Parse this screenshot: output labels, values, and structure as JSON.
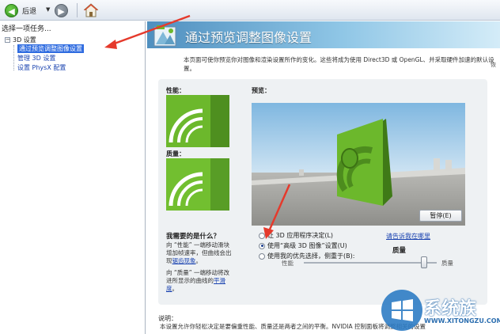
{
  "toolbar": {
    "back_label": "后退",
    "back_icon": "arrow-left-icon",
    "forward_icon": "arrow-right-icon",
    "home_icon": "home-icon",
    "dropdown_glyph": "▼"
  },
  "sidebar": {
    "title": "选择一项任务...",
    "root": {
      "label": "3D 设置",
      "expander": "−"
    },
    "items": [
      {
        "label": "通过预览调整图像设置",
        "selected": true
      },
      {
        "label": "管理 3D 设置",
        "selected": false
      },
      {
        "label": "设置 PhysX 配置",
        "selected": false
      }
    ]
  },
  "header": {
    "title": "通过预览调整图像设置",
    "icon": "nvidia-3d-settings-icon"
  },
  "description": "本页面可使你预览你对图像和渲染设置所作的变化。这些将成为使用 Direct3D 或 OpenGL、并采取硬件加速的默认设置。",
  "edge_text": "恢",
  "panel": {
    "performance_label": "性能：",
    "quality_label": "质量：",
    "preview_label": "预览：",
    "question_title": "我需要的是什么？",
    "performance_help": "向 “性能” 一端移动滑块增加帧速率，但曲线会出现",
    "performance_link": "锯齿现象",
    "quality_help": "向 “质量” 一端移动将改进所显示的曲线的",
    "quality_link": "平滑度",
    "pause_button": "暂停(E)",
    "options": [
      {
        "label": "让 3D 应用程序决定(L)",
        "checked": false
      },
      {
        "label": "使用“高级 3D 图像”设置(U)",
        "checked": true
      },
      {
        "label": "使用我的优先选择，侧重于(B):",
        "checked": false
      }
    ],
    "help_link": "请告诉我在哪里",
    "quality_emphasis": "质量",
    "slider": {
      "left_label": "性能",
      "right_label": "质量",
      "value_fraction": 0.9
    }
  },
  "bottom": {
    "title": "说明：",
    "text": "本设置允许你轻松决定是要偏重性能、质量还是两者之间的平衡。NVIDIA 控制面板将调整相关的设置"
  },
  "watermark": {
    "text": "系统族",
    "url": "WWW.XITONGZU.COM",
    "icon": "windows-logo-icon"
  },
  "colors": {
    "accent_blue": "#2e6be0",
    "nvidia_green": "#6cb82c",
    "annotation_red": "#e53a2c"
  }
}
